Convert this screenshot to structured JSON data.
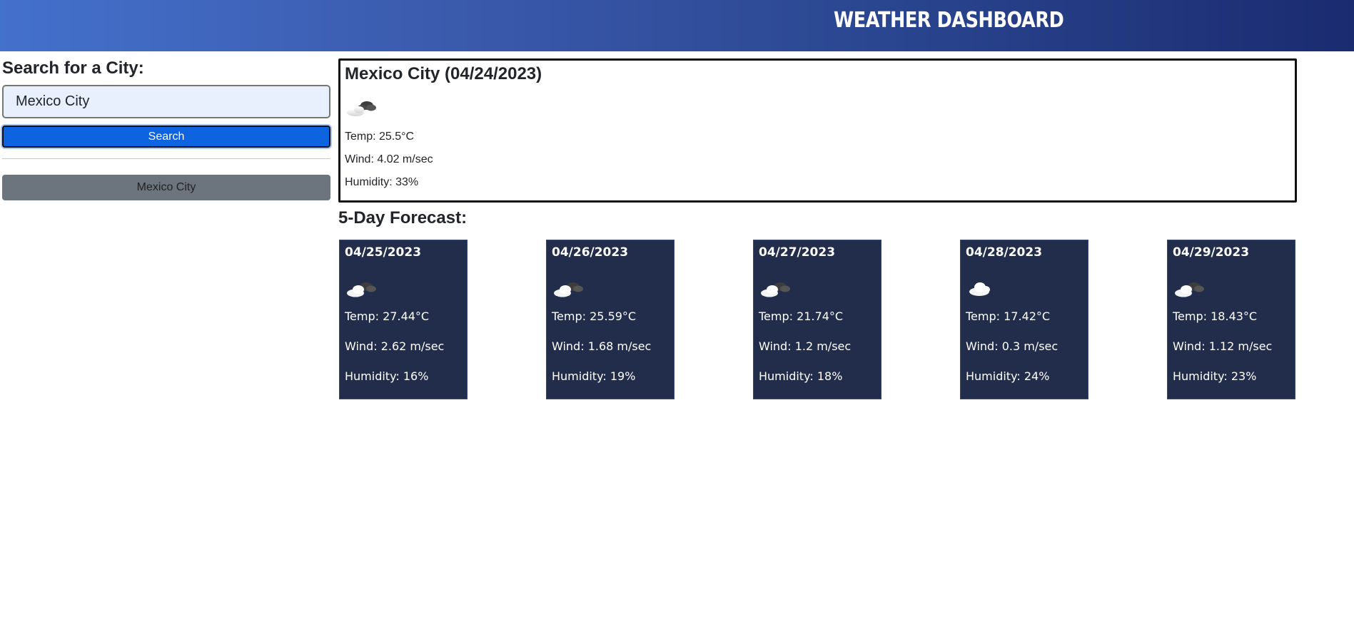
{
  "header": {
    "title": "WEATHER DASHBOARD"
  },
  "sidebar": {
    "heading": "Search for a City:",
    "search_value": "Mexico City",
    "search_button_label": "Search",
    "history": [
      "Mexico City"
    ]
  },
  "current": {
    "title": "Mexico City (04/24/2023)",
    "icon": "few-clouds-icon",
    "temp": "Temp: 25.5°C",
    "wind": "Wind: 4.02 m/sec",
    "humidity": "Humidity: 33%"
  },
  "forecast": {
    "heading": "5-Day Forecast:",
    "days": [
      {
        "date": "04/25/2023",
        "icon": "broken-clouds-icon",
        "temp": "Temp: 27.44°C",
        "wind": "Wind: 2.62 m/sec",
        "humidity": "Humidity: 16%"
      },
      {
        "date": "04/26/2023",
        "icon": "broken-clouds-icon",
        "temp": "Temp: 25.59°C",
        "wind": "Wind: 1.68 m/sec",
        "humidity": "Humidity: 19%"
      },
      {
        "date": "04/27/2023",
        "icon": "broken-clouds-icon",
        "temp": "Temp: 21.74°C",
        "wind": "Wind: 1.2 m/sec",
        "humidity": "Humidity: 18%"
      },
      {
        "date": "04/28/2023",
        "icon": "scattered-clouds-icon",
        "temp": "Temp: 17.42°C",
        "wind": "Wind: 0.3 m/sec",
        "humidity": "Humidity: 24%"
      },
      {
        "date": "04/29/2023",
        "icon": "broken-clouds-icon",
        "temp": "Temp: 18.43°C",
        "wind": "Wind: 1.12 m/sec",
        "humidity": "Humidity: 23%"
      }
    ]
  },
  "colors": {
    "header_gradient_start": "#4471cc",
    "header_gradient_end": "#1b2b70",
    "search_button": "#0d63e0",
    "history_button": "#6c757d",
    "forecast_card": "#212d4a"
  }
}
